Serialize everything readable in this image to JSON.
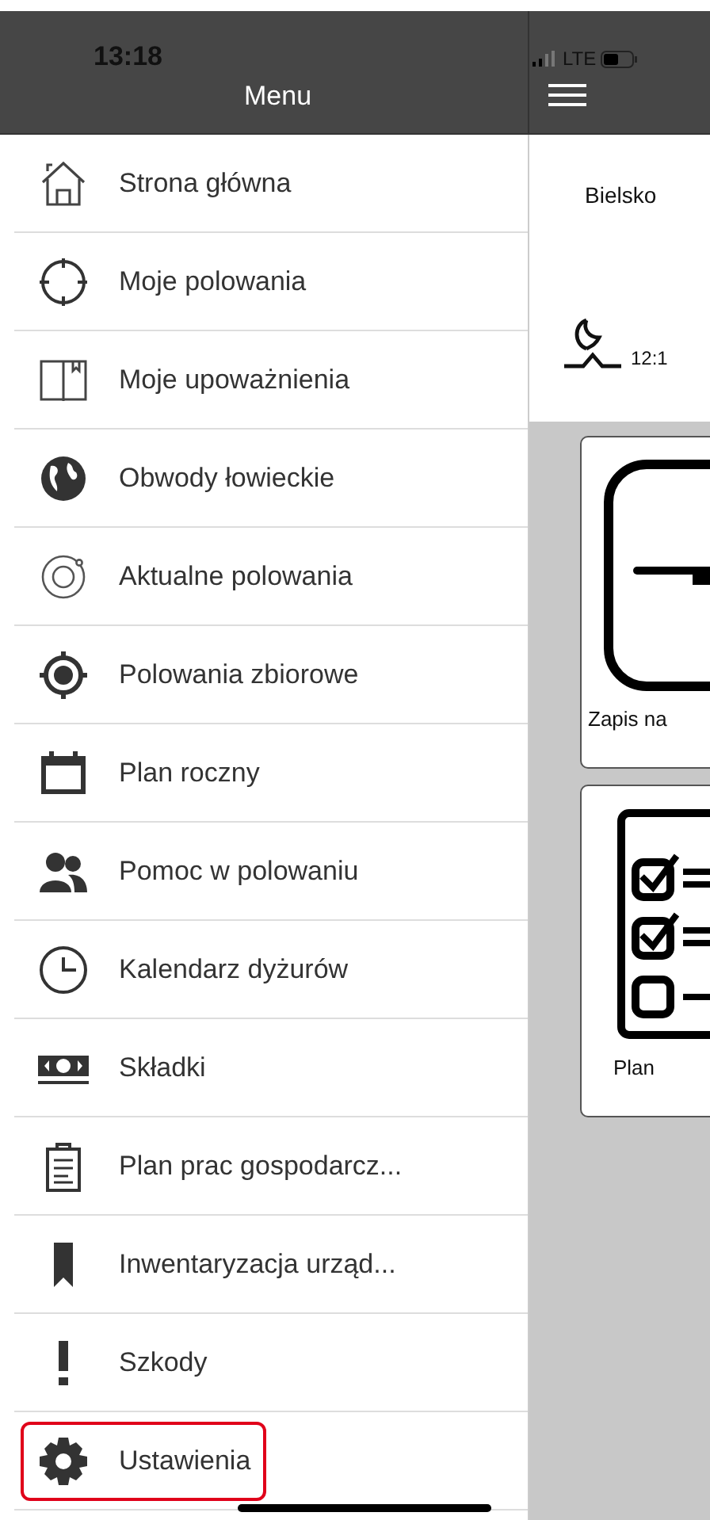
{
  "status_bar": {
    "time": "13:18",
    "network": "LTE"
  },
  "menu": {
    "title": "Menu",
    "items": [
      {
        "label": "Strona główna",
        "highlighted": false
      },
      {
        "label": "Moje polowania",
        "highlighted": false
      },
      {
        "label": "Moje upoważnienia",
        "highlighted": false
      },
      {
        "label": "Obwody łowieckie",
        "highlighted": false
      },
      {
        "label": "Aktualne polowania",
        "highlighted": false
      },
      {
        "label": "Polowania zbiorowe",
        "highlighted": false
      },
      {
        "label": "Plan roczny",
        "highlighted": false
      },
      {
        "label": "Pomoc w polowaniu",
        "highlighted": false
      },
      {
        "label": "Kalendarz dyżurów",
        "highlighted": false
      },
      {
        "label": "Składki",
        "highlighted": false
      },
      {
        "label": "Plan prac gospodarcz...",
        "highlighted": false
      },
      {
        "label": "Inwentaryzacja urząd...",
        "highlighted": false
      },
      {
        "label": "Szkody",
        "highlighted": false
      },
      {
        "label": "Ustawienia",
        "highlighted": true
      }
    ]
  },
  "main": {
    "location": "Bielsko",
    "moon_time": "12:1",
    "tiles": [
      {
        "label": "Zapis na"
      },
      {
        "label": "Plan"
      }
    ]
  }
}
